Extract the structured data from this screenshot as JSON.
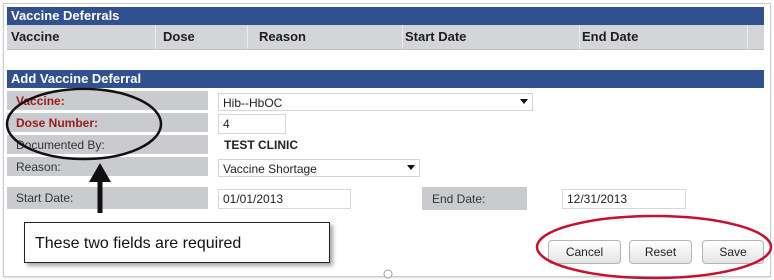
{
  "deferrals": {
    "title": "Vaccine Deferrals",
    "columns": [
      "Vaccine",
      "Dose",
      "Reason",
      "Start Date",
      "End Date"
    ]
  },
  "add_deferral": {
    "title": "Add Vaccine Deferral",
    "vaccine": {
      "label": "Vaccine:",
      "value": "Hib--HbOC"
    },
    "dose_number": {
      "label": "Dose Number:",
      "value": "4"
    },
    "documented_by": {
      "label": "Documented By:",
      "value": "TEST CLINIC"
    },
    "reason": {
      "label": "Reason:",
      "value": "Vaccine Shortage"
    },
    "start_date": {
      "label": "Start Date:",
      "value": "01/01/2013"
    },
    "end_date": {
      "label": "End Date:",
      "value": "12/31/2013"
    }
  },
  "buttons": {
    "cancel": "Cancel",
    "reset": "Reset",
    "save": "Save"
  },
  "annotation": {
    "callout_text": "These two fields are required"
  },
  "colors": {
    "header_bg": "#30508f",
    "required_label": "#9b1b1b",
    "annotation_ring_red": "#c8102e",
    "annotation_ring_black": "#111111"
  }
}
